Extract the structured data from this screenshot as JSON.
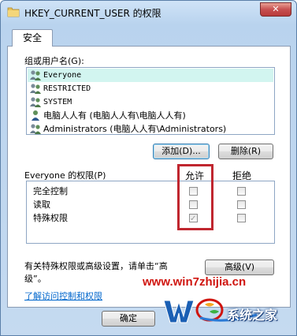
{
  "window": {
    "title": "HKEY_CURRENT_USER 的权限",
    "close_label": "✕"
  },
  "tabs": [
    {
      "label": "安全",
      "selected": true
    }
  ],
  "groups": {
    "label": "组或用户名(G):",
    "items": [
      {
        "name": "Everyone",
        "icon": "users-group-icon",
        "selected": true
      },
      {
        "name": "RESTRICTED",
        "icon": "users-group-icon",
        "selected": true
      },
      {
        "name": "SYSTEM",
        "icon": "users-group-icon",
        "selected": true
      },
      {
        "name": "电脑人人有 (电脑人人有\\电脑人人有)",
        "icon": "user-icon",
        "selected": true
      },
      {
        "name": "Administrators (电脑人人有\\Administrators)",
        "icon": "users-group-icon",
        "selected": true
      }
    ],
    "add_button": "添加(D)...",
    "remove_button": "删除(R)"
  },
  "permissions": {
    "header_label": "Everyone 的权限(P)",
    "allow_header": "允许",
    "deny_header": "拒绝",
    "rows": [
      {
        "name": "完全控制",
        "allow": false,
        "deny": false
      },
      {
        "name": "读取",
        "allow": false,
        "deny": false
      },
      {
        "name": "特殊权限",
        "allow": true,
        "deny": false
      }
    ]
  },
  "advanced": {
    "text": "有关特殊权限或高级设置，请单击“高级”。",
    "text_line1": "有关特殊权限或高级设置，请单击“高",
    "text_line2": "级”。",
    "button": "高级(V)"
  },
  "help_link": "了解访问控制和权限",
  "footer": {
    "ok_button": "确定"
  },
  "watermark": {
    "url": "www.win7zhijia.cn",
    "site": "系统之家",
    "accent": "#d0140e"
  },
  "colors": {
    "selection": "#d2f5f0",
    "highlight_border": "#c0262f",
    "link": "#0066cc"
  }
}
